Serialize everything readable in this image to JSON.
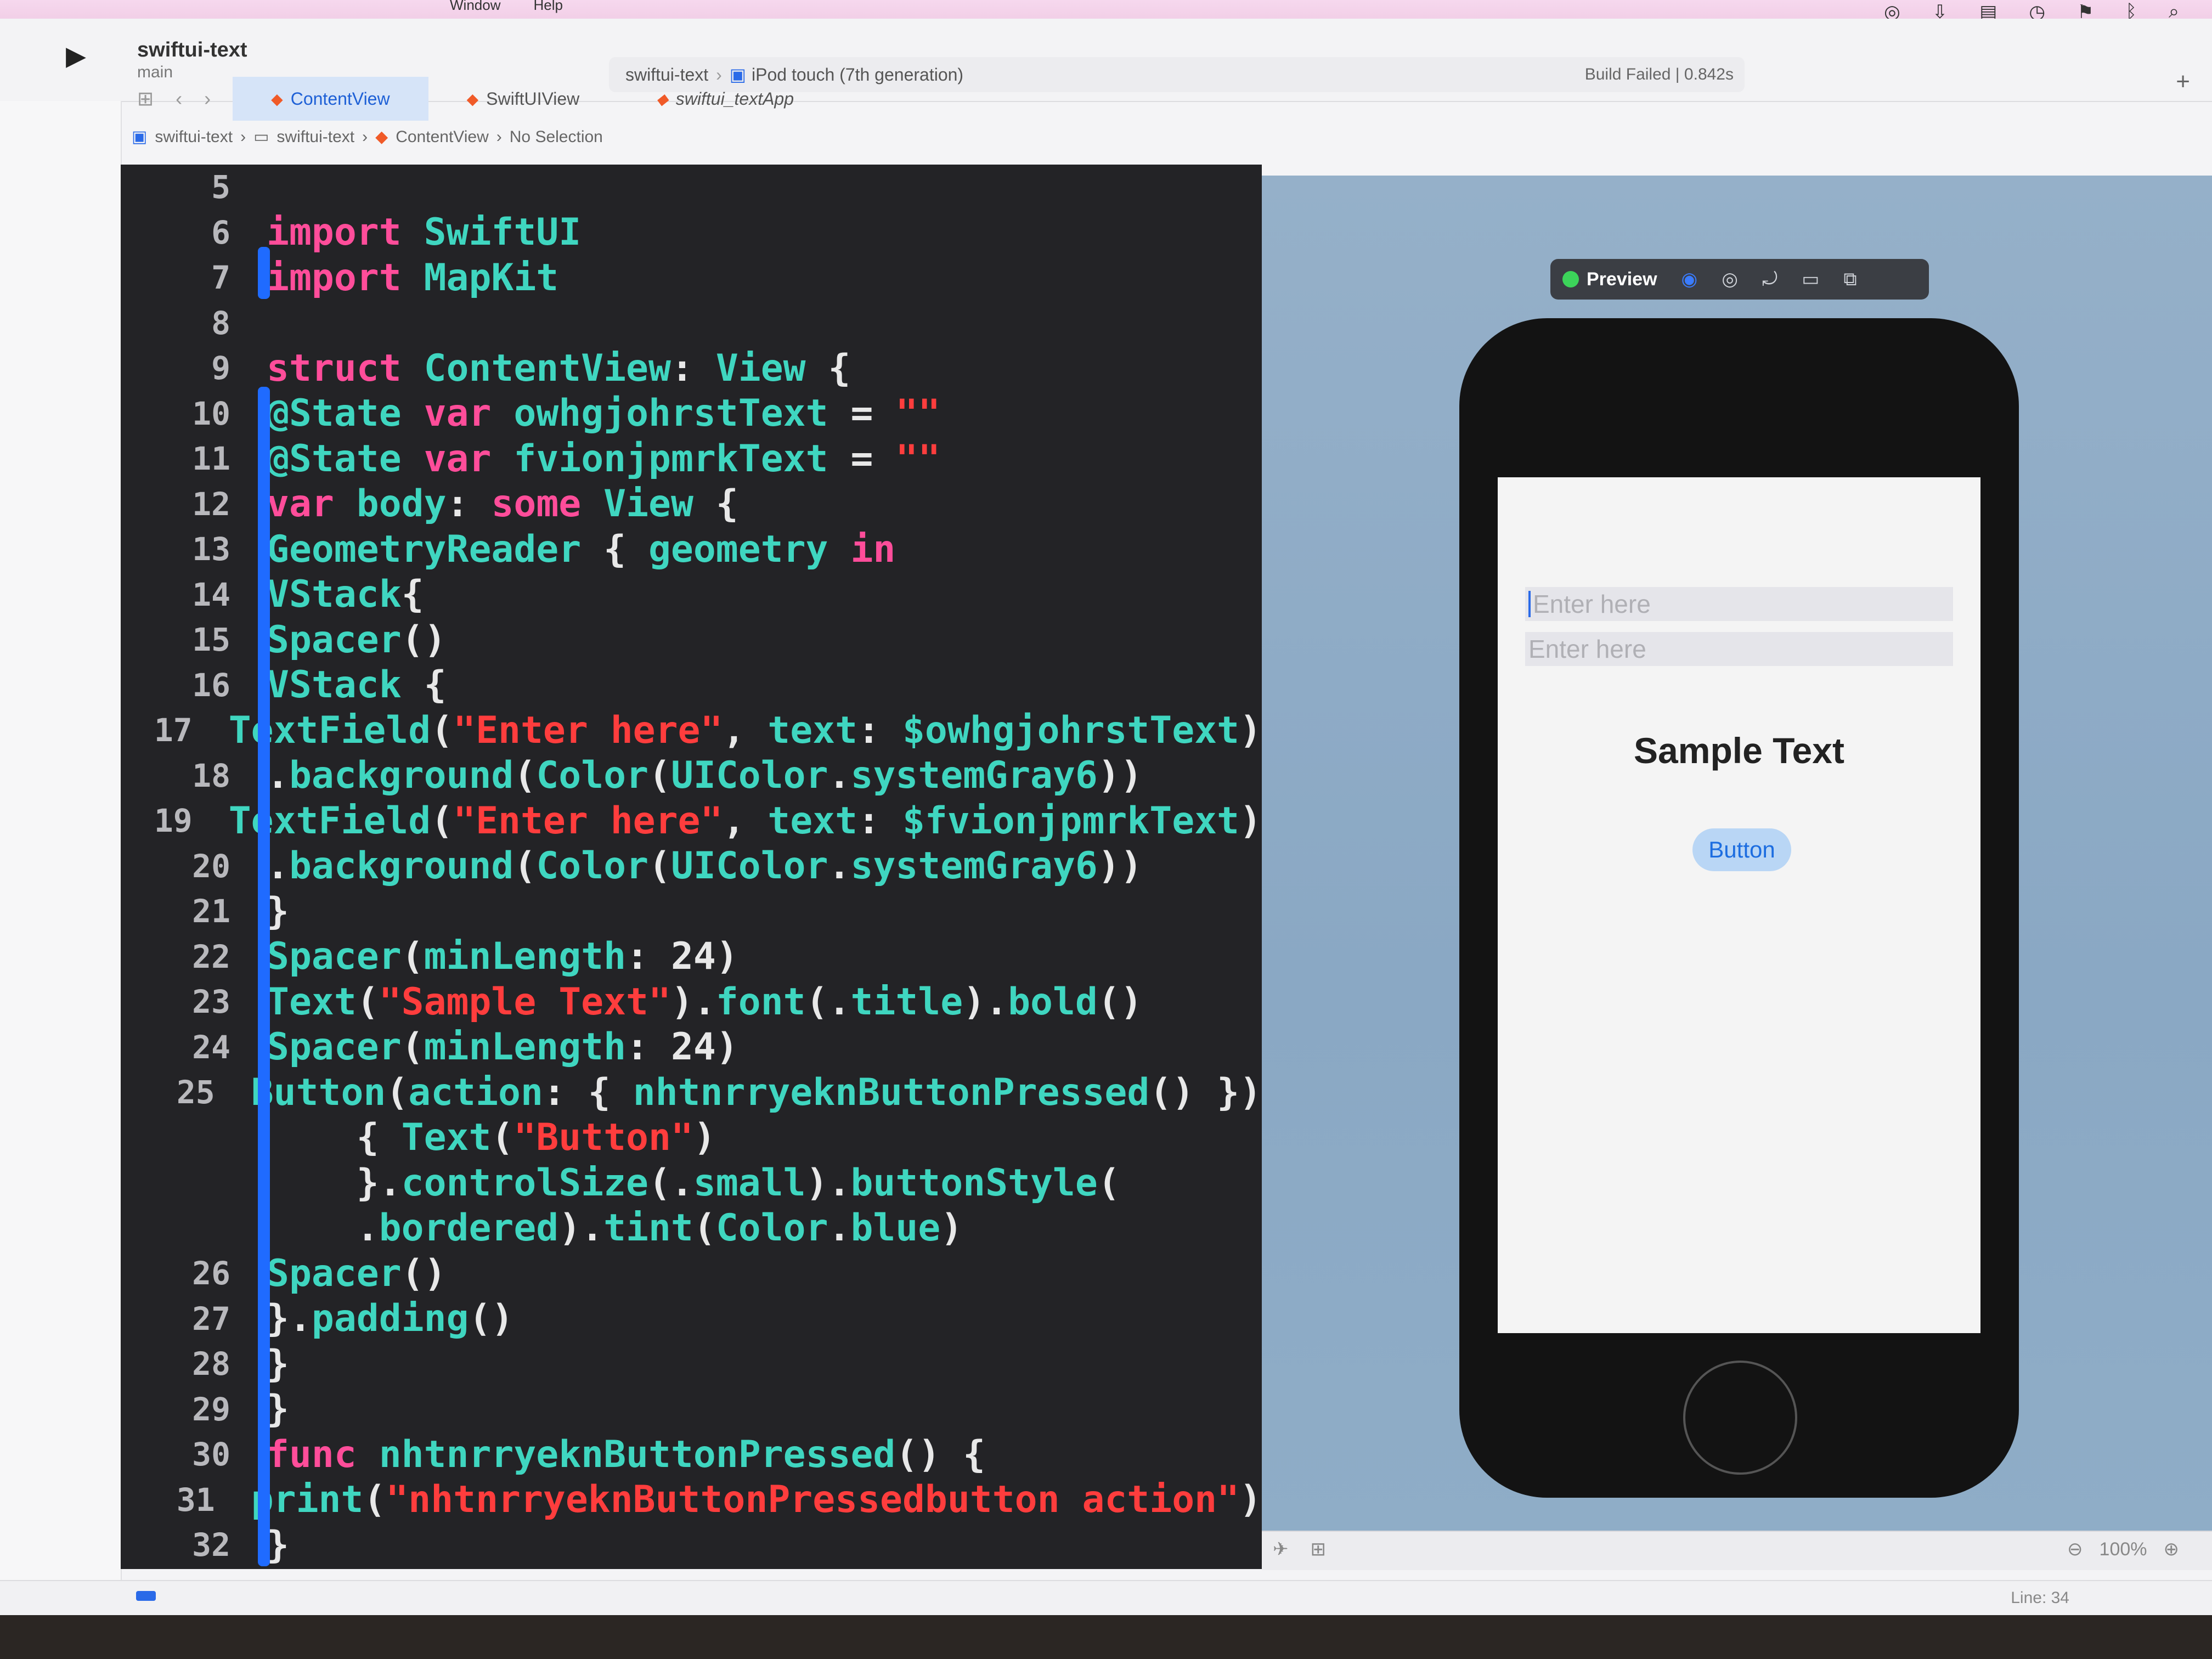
{
  "menu": {
    "items": [
      "Window",
      "Help"
    ]
  },
  "toolbar": {
    "project_name": "swiftui-text",
    "branch": "main",
    "scheme": "swiftui-text",
    "device": "iPod touch (7th generation)",
    "build_status": "Build Failed | 0.842s"
  },
  "tabs": [
    {
      "label": "ContentView",
      "active": true
    },
    {
      "label": "SwiftUIView",
      "active": false
    },
    {
      "label": "swiftui_textApp",
      "active": false
    }
  ],
  "breadcrumb": [
    "swiftui-text",
    "swiftui-text",
    "ContentView",
    "No Selection"
  ],
  "editor": {
    "lines": [
      {
        "n": "5",
        "code": ""
      },
      {
        "n": "6",
        "code": "import SwiftUI"
      },
      {
        "n": "7",
        "code": "import MapKit"
      },
      {
        "n": "8",
        "code": ""
      },
      {
        "n": "9",
        "code": "struct ContentView: View {"
      },
      {
        "n": "10",
        "code": "@State var owhgjohrstText = \"\""
      },
      {
        "n": "11",
        "code": "@State var fvionjpmrkText = \"\""
      },
      {
        "n": "12",
        "code": "var body: some View {"
      },
      {
        "n": "13",
        "code": "GeometryReader { geometry in"
      },
      {
        "n": "14",
        "code": "VStack{"
      },
      {
        "n": "15",
        "code": "Spacer()"
      },
      {
        "n": "16",
        "code": "VStack {"
      },
      {
        "n": "17",
        "code": "TextField(\"Enter here\", text: $owhgjohrstText)"
      },
      {
        "n": "18",
        "code": ".background(Color(UIColor.systemGray6))"
      },
      {
        "n": "19",
        "code": "TextField(\"Enter here\", text: $fvionjpmrkText)"
      },
      {
        "n": "20",
        "code": ".background(Color(UIColor.systemGray6))"
      },
      {
        "n": "21",
        "code": "}"
      },
      {
        "n": "22",
        "code": "Spacer(minLength: 24)"
      },
      {
        "n": "23",
        "code": "Text(\"Sample Text\").font(.title).bold()"
      },
      {
        "n": "24",
        "code": "Spacer(minLength: 24)"
      },
      {
        "n": "25",
        "code": "Button(action: { nhtnrryeknButtonPressed() })"
      },
      {
        "n": "",
        "code": "    { Text(\"Button\")"
      },
      {
        "n": "",
        "code": "    }.controlSize(.small).buttonStyle("
      },
      {
        "n": "",
        "code": "    .bordered).tint(Color.blue)"
      },
      {
        "n": "26",
        "code": "Spacer()"
      },
      {
        "n": "27",
        "code": "}.padding()"
      },
      {
        "n": "28",
        "code": "}"
      },
      {
        "n": "29",
        "code": "}"
      },
      {
        "n": "30",
        "code": "func nhtnrryeknButtonPressed() {"
      },
      {
        "n": "31",
        "code": "print(\"nhtnrryeknButtonPressedbutton action\")"
      },
      {
        "n": "32",
        "code": "}"
      }
    ]
  },
  "preview": {
    "label": "Preview",
    "textfield1_placeholder": "Enter here",
    "textfield2_placeholder": "Enter here",
    "sample_text": "Sample Text",
    "button_label": "Button",
    "zoom": "100%"
  },
  "statusbar": {
    "line_info": "Line: 34"
  },
  "colors": {
    "keyword": "#ff4d9a",
    "type": "#3fd6c0",
    "string": "#ff3d3d",
    "accent": "#2a6ae8"
  }
}
